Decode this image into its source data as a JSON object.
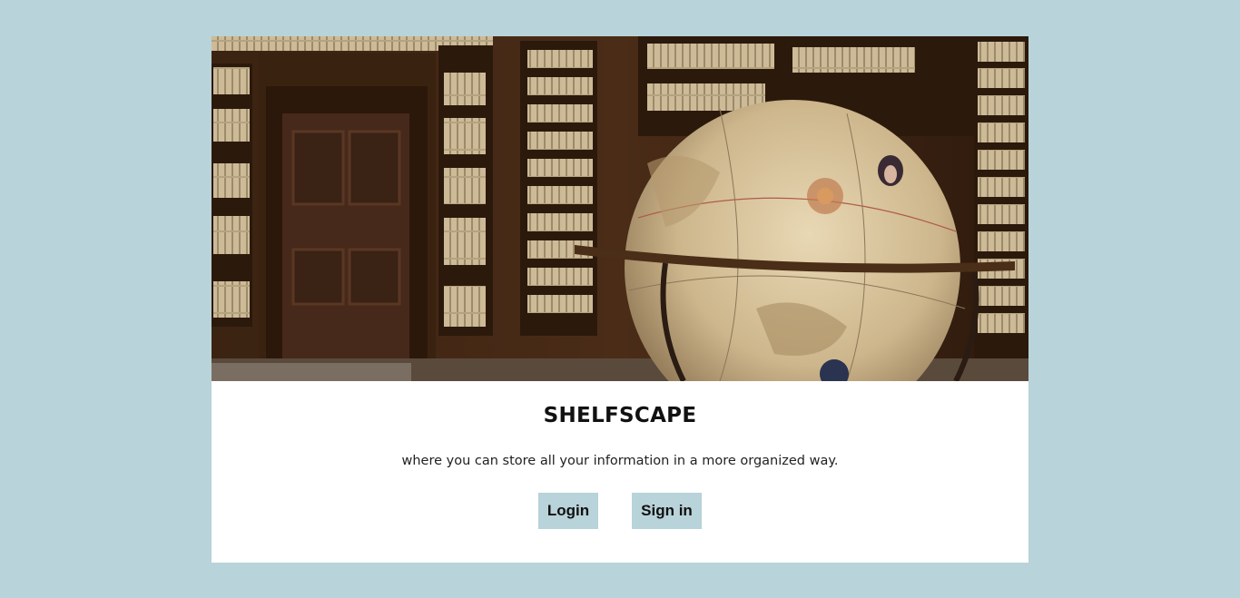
{
  "colors": {
    "page_background": "#b8d3d9",
    "card_background": "#ffffff",
    "button_background": "#b8d3d9",
    "text": "#111111"
  },
  "hero": {
    "image_subject": "library-globe-photo"
  },
  "brand": {
    "title": "SHELFSCAPE",
    "tagline": "where you can store all your information in a more organized way."
  },
  "actions": {
    "login_label": "Login",
    "signin_label": "Sign in"
  }
}
